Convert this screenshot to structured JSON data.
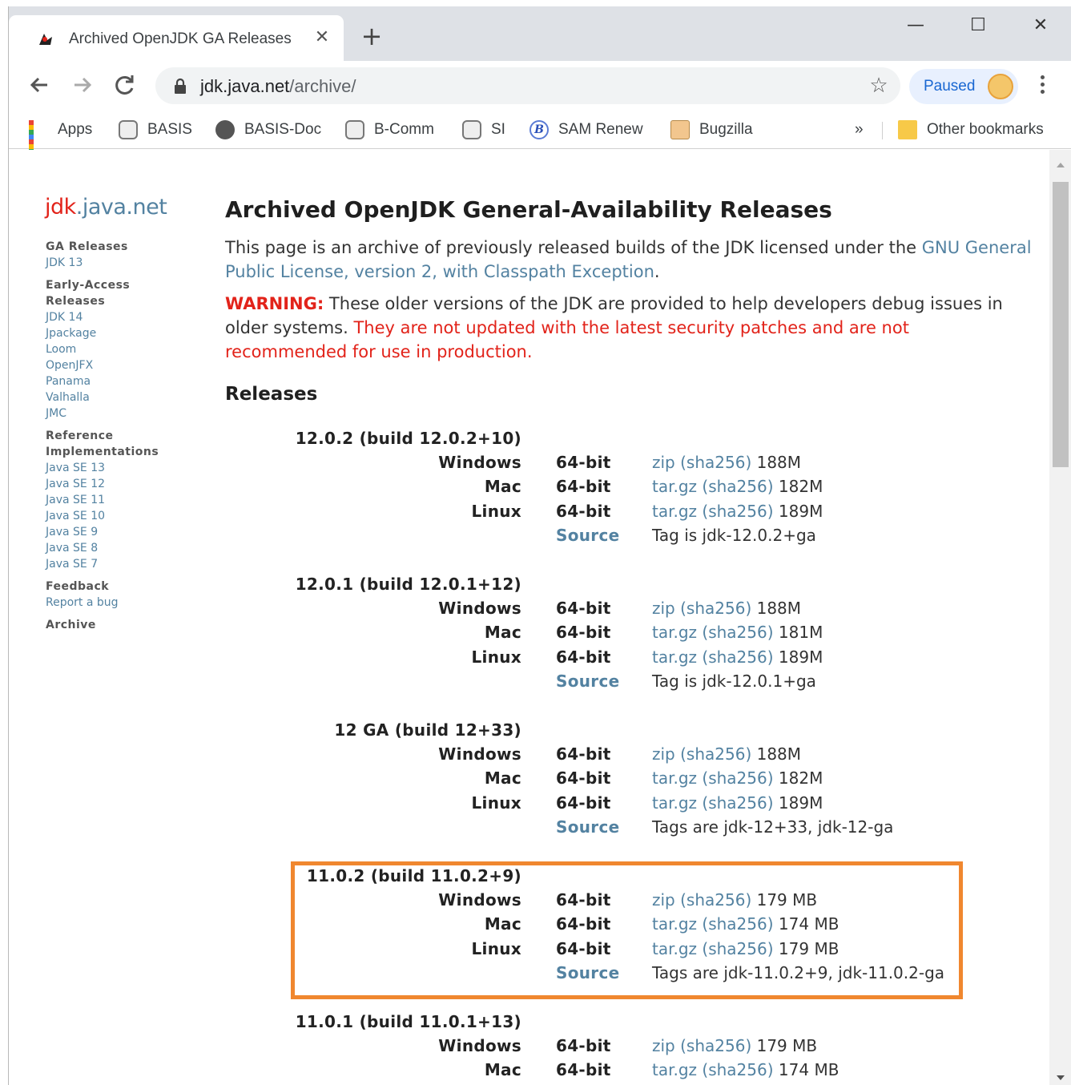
{
  "browser": {
    "tab_title": "Archived OpenJDK GA Releases",
    "tab_close": "✕",
    "new_tab": "+",
    "window_controls": {
      "minimize": "—",
      "maximize": "☐",
      "close": "✕"
    },
    "url_host": "jdk.java.net",
    "url_path": "/archive/",
    "paused_label": "Paused",
    "bookmarks": [
      {
        "label": "Apps",
        "icon": "apps-icon"
      },
      {
        "label": "BASIS",
        "icon": "database-icon"
      },
      {
        "label": "BASIS-Doc",
        "icon": "globe-icon"
      },
      {
        "label": "B-Comm",
        "icon": "database-icon"
      },
      {
        "label": "SI",
        "icon": "database-icon"
      },
      {
        "label": "SAM Renew",
        "icon": "b-icon"
      },
      {
        "label": "Bugzilla",
        "icon": "bugzilla-icon"
      }
    ],
    "more_bookmarks": "»",
    "other_bookmarks": "Other bookmarks"
  },
  "site": {
    "logo_a": "jdk",
    "logo_b": ".java.net"
  },
  "sidenav": [
    {
      "type": "h",
      "text": "GA Releases"
    },
    {
      "type": "l",
      "text": "JDK 13"
    },
    {
      "type": "h",
      "text": "Early-Access Releases"
    },
    {
      "type": "l",
      "text": "JDK 14"
    },
    {
      "type": "l",
      "text": "Jpackage"
    },
    {
      "type": "l",
      "text": "Loom"
    },
    {
      "type": "l",
      "text": "OpenJFX"
    },
    {
      "type": "l",
      "text": "Panama"
    },
    {
      "type": "l",
      "text": "Valhalla"
    },
    {
      "type": "l",
      "text": "JMC"
    },
    {
      "type": "h",
      "text": "Reference Implementations"
    },
    {
      "type": "l",
      "text": "Java SE 13"
    },
    {
      "type": "l",
      "text": "Java SE 12"
    },
    {
      "type": "l",
      "text": "Java SE 11"
    },
    {
      "type": "l",
      "text": "Java SE 10"
    },
    {
      "type": "l",
      "text": "Java SE 9"
    },
    {
      "type": "l",
      "text": "Java SE 8"
    },
    {
      "type": "l",
      "text": "Java SE 7"
    },
    {
      "type": "h",
      "text": "Feedback"
    },
    {
      "type": "l",
      "text": "Report a bug"
    },
    {
      "type": "h",
      "text": "Archive"
    }
  ],
  "main": {
    "title": "Archived OpenJDK General-Availability Releases",
    "intro_text": "This page is an archive of previously released builds of the JDK licensed under the",
    "intro_link": "GNU General Public License, version 2, with Classpath Exception",
    "warning_label": "WARNING:",
    "warning_text": " These older versions of the JDK are provided to help developers debug issues in older systems. ",
    "warning_red": "They are not updated with the latest security patches and are not recommended for use in production.",
    "releases_heading": "Releases"
  },
  "releases": [
    {
      "title": "12.0.2 (build 12.0.2+10)",
      "rows": [
        {
          "os": "Windows",
          "arch": "64-bit",
          "file": "zip",
          "sha": "(sha256)",
          "size": "188M"
        },
        {
          "os": "Mac",
          "arch": "64-bit",
          "file": "tar.gz",
          "sha": "(sha256)",
          "size": "182M"
        },
        {
          "os": "Linux",
          "arch": "64-bit",
          "file": "tar.gz",
          "sha": "(sha256)",
          "size": "189M"
        }
      ],
      "source": "Source",
      "tag": "Tag is jdk-12.0.2+ga"
    },
    {
      "title": "12.0.1 (build 12.0.1+12)",
      "rows": [
        {
          "os": "Windows",
          "arch": "64-bit",
          "file": "zip",
          "sha": "(sha256)",
          "size": "188M"
        },
        {
          "os": "Mac",
          "arch": "64-bit",
          "file": "tar.gz",
          "sha": "(sha256)",
          "size": "181M"
        },
        {
          "os": "Linux",
          "arch": "64-bit",
          "file": "tar.gz",
          "sha": "(sha256)",
          "size": "189M"
        }
      ],
      "source": "Source",
      "tag": "Tag is jdk-12.0.1+ga"
    },
    {
      "title": "12 GA (build 12+33)",
      "rows": [
        {
          "os": "Windows",
          "arch": "64-bit",
          "file": "zip",
          "sha": "(sha256)",
          "size": "188M"
        },
        {
          "os": "Mac",
          "arch": "64-bit",
          "file": "tar.gz",
          "sha": "(sha256)",
          "size": "182M"
        },
        {
          "os": "Linux",
          "arch": "64-bit",
          "file": "tar.gz",
          "sha": "(sha256)",
          "size": "189M"
        }
      ],
      "source": "Source",
      "tag": "Tags are jdk-12+33, jdk-12-ga"
    },
    {
      "title": "11.0.2 (build 11.0.2+9)",
      "rows": [
        {
          "os": "Windows",
          "arch": "64-bit",
          "file": "zip",
          "sha": "(sha256)",
          "size": "179 MB"
        },
        {
          "os": "Mac",
          "arch": "64-bit",
          "file": "tar.gz",
          "sha": "(sha256)",
          "size": "174 MB"
        },
        {
          "os": "Linux",
          "arch": "64-bit",
          "file": "tar.gz",
          "sha": "(sha256)",
          "size": "179 MB"
        }
      ],
      "source": "Source",
      "tag": "Tags are jdk-11.0.2+9, jdk-11.0.2-ga"
    },
    {
      "title": "11.0.1 (build 11.0.1+13)",
      "rows": [
        {
          "os": "Windows",
          "arch": "64-bit",
          "file": "zip",
          "sha": "(sha256)",
          "size": "179 MB"
        },
        {
          "os": "Mac",
          "arch": "64-bit",
          "file": "tar.gz",
          "sha": "(sha256)",
          "size": "174 MB"
        }
      ],
      "source": "",
      "tag": ""
    }
  ],
  "colors": {
    "highlight": "#f0872f",
    "link": "#5382a1",
    "warning": "#e2231a"
  }
}
